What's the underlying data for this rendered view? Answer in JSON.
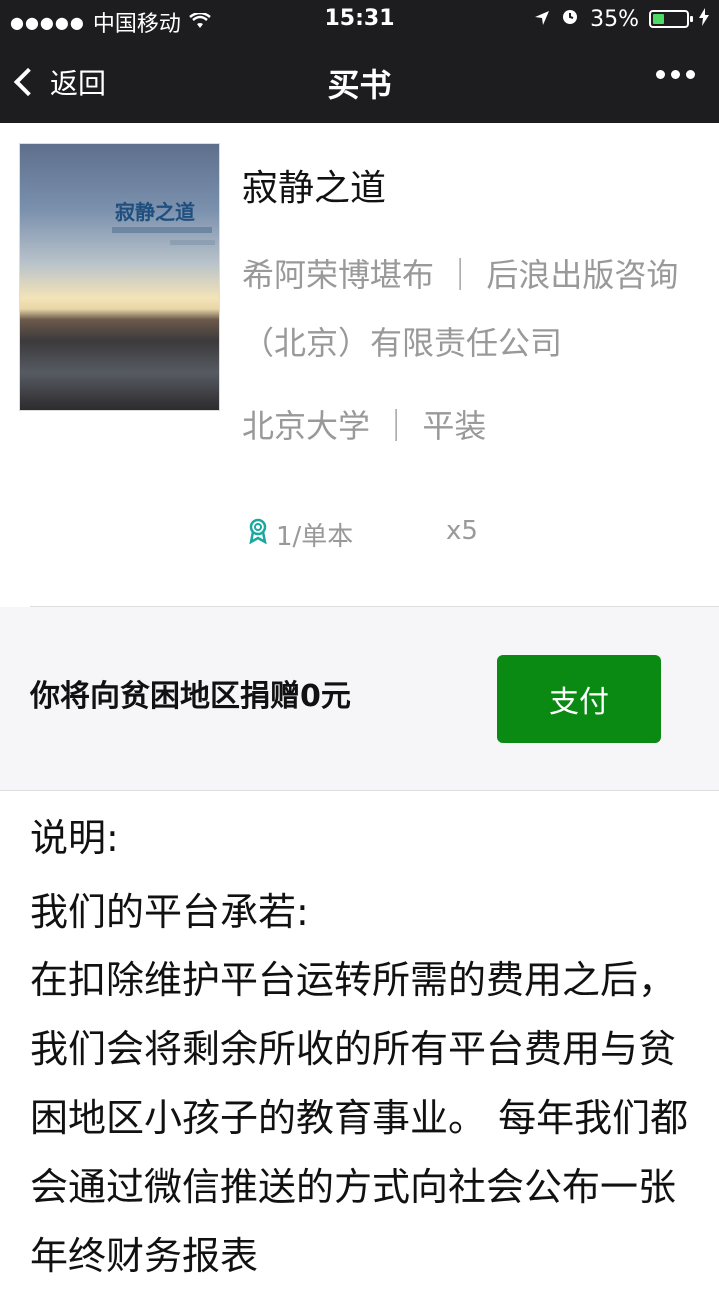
{
  "status_bar": {
    "signal": "●●●●●",
    "carrier": "中国移动",
    "time": "15:31",
    "battery_percent": "35%",
    "battery_level": 0.35
  },
  "nav": {
    "back_label": "返回",
    "title": "买书"
  },
  "book": {
    "title": "寂静之道",
    "cover_title": "寂静之道",
    "author_publisher": "希阿荣博堪布 ｜ 后浪出版咨询（北京）有限责任公司",
    "press_binding": "北京大学 ｜ 平装",
    "stock": "1/单本",
    "quantity": "x5"
  },
  "donation": {
    "text": "你将向贫困地区捐赠0元",
    "pay_label": "支付",
    "pay_color": "#0a8a13"
  },
  "description": {
    "heading": "说明:",
    "promise": "我们的平台承若:",
    "body": "在扣除维护平台运转所需的费用之后，我们会将剩余所收的所有平台费用与贫困地区小孩子的教育事业。 每年我们都会通过微信推送的方式向社会公布一张年终财务报表"
  }
}
